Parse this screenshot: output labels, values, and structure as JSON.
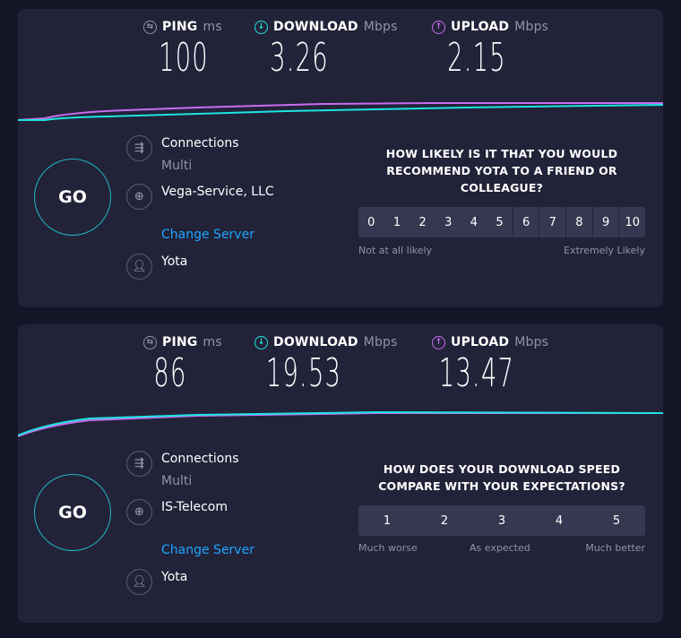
{
  "tests": [
    {
      "ping_label": "PING",
      "ping_unit": "ms",
      "ping": "100",
      "download_label": "DOWNLOAD",
      "download_unit": "Mbps",
      "download": "3.26",
      "upload_label": "UPLOAD",
      "upload_unit": "Mbps",
      "upload": "2.15",
      "go": "GO",
      "connections_label": "Connections",
      "connections_value": "Multi",
      "server": "Vega-Service, LLC",
      "change_server": "Change Server",
      "provider": "Yota",
      "question": "HOW LIKELY IS IT THAT YOU WOULD RECOMMEND YOTA TO A FRIEND OR COLLEAGUE?",
      "scale": [
        "0",
        "1",
        "2",
        "3",
        "4",
        "5",
        "6",
        "7",
        "8",
        "9",
        "10"
      ],
      "low_label": "Not at all likely",
      "high_label": "Extremely Likely"
    },
    {
      "ping_label": "PING",
      "ping_unit": "ms",
      "ping": "86",
      "download_label": "DOWNLOAD",
      "download_unit": "Mbps",
      "download": "19.53",
      "upload_label": "UPLOAD",
      "upload_unit": "Mbps",
      "upload": "13.47",
      "go": "GO",
      "connections_label": "Connections",
      "connections_value": "Multi",
      "server": "IS-Telecom",
      "change_server": "Change Server",
      "provider": "Yota",
      "question": "HOW DOES YOUR DOWNLOAD SPEED COMPARE WITH YOUR EXPECTATIONS?",
      "scale": [
        "1",
        "2",
        "3",
        "4",
        "5"
      ],
      "low_label": "Much worse",
      "mid_label": "As expected",
      "high_label": "Much better"
    }
  ],
  "colors": {
    "download": "#1de5e0",
    "upload": "#c86cf0",
    "link": "#1ea5ff"
  }
}
